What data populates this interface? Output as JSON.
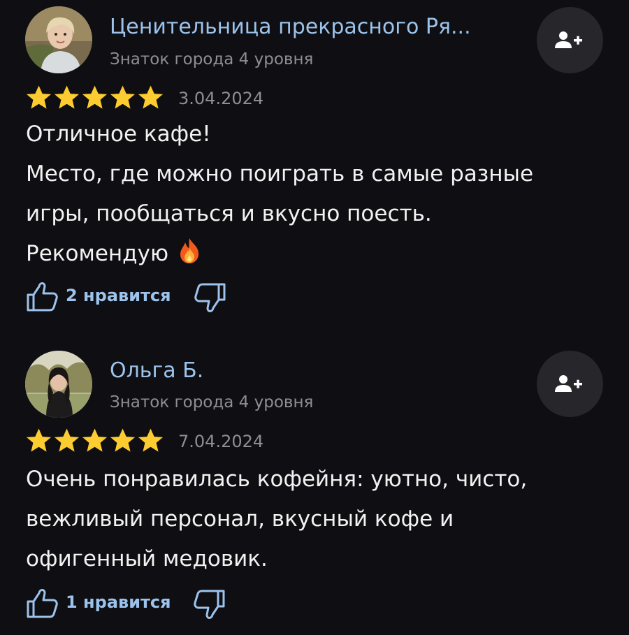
{
  "colors": {
    "background": "#0f0e12",
    "accent_link": "#9cc3ec",
    "star": "#fccc30",
    "secondary_text": "#8f8f93",
    "button_bg": "#27262b"
  },
  "reviews": [
    {
      "author_name": "Ценительница прекрасного Ря...",
      "author_level": "Знаток города 4 уровня",
      "rating": 5,
      "date": "3.04.2024",
      "text_lines": [
        "Отличное кафе!",
        "Место, где можно поиграть в самые разные",
        "игры, пообщаться и вкусно поесть.",
        "Рекомендую"
      ],
      "emoji": "fire-icon",
      "likes_label": "2 нравится"
    },
    {
      "author_name": "Ольга Б.",
      "author_level": "Знаток города 4 уровня",
      "rating": 5,
      "date": "7.04.2024",
      "text_lines": [
        "Очень понравилась кофейня: уютно, чисто,",
        "вежливый персонал, вкусный кофе и",
        "офигенный медовик."
      ],
      "likes_label": "1 нравится"
    }
  ]
}
